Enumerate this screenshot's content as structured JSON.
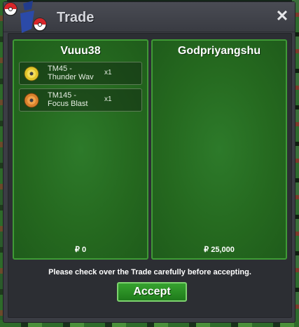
{
  "window": {
    "title": "Trade"
  },
  "left_panel": {
    "player": "Vuuu38",
    "items": [
      {
        "name_line1": "TM45 -",
        "name_line2": "Thunder Wav",
        "qty": "x1",
        "icon": "yellow-disc-icon"
      },
      {
        "name_line1": "TM145 -",
        "name_line2": "Focus Blast",
        "qty": "x1",
        "icon": "orange-disc-icon"
      }
    ],
    "money": "₽ 0"
  },
  "right_panel": {
    "player": "Godpriyangshu",
    "items": [],
    "money": "₽ 25,000"
  },
  "notice": "Please check over the Trade carefully before accepting.",
  "accept_label": "Accept",
  "colors": {
    "panel": "#25691f",
    "accent": "#3f9a36",
    "window": "#3b3d44"
  }
}
